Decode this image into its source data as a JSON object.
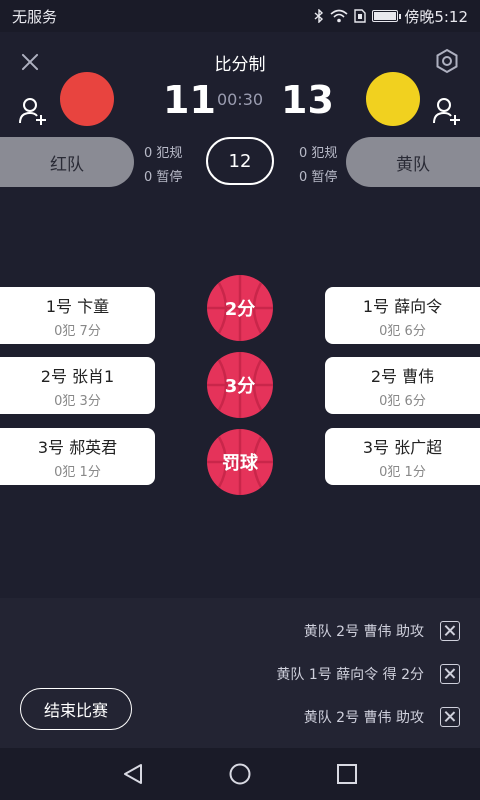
{
  "status_bar": {
    "carrier": "无服务",
    "time": "傍晚5:12",
    "icons": [
      "bluetooth-icon",
      "wifi-icon",
      "sim-icon",
      "battery-icon"
    ],
    "battery_level": 0.9
  },
  "header": {
    "title": "比分制",
    "clock": "00:30",
    "close_icon": "close-icon",
    "settings_icon": "settings-icon"
  },
  "teams": {
    "left": {
      "name": "红队",
      "color": "#e8443f",
      "score": "11",
      "fouls": "0 犯规",
      "timeouts": "0 暂停"
    },
    "right": {
      "name": "黄队",
      "color": "#f1d11f",
      "score": "13",
      "fouls": "0 犯规",
      "timeouts": "0 暂停"
    }
  },
  "period": "12",
  "players_left": [
    {
      "name": "1号 卞童",
      "stats": "0犯 7分"
    },
    {
      "name": "2号 张肖1",
      "stats": "0犯 3分"
    },
    {
      "name": "3号 郝英君",
      "stats": "0犯 1分"
    }
  ],
  "players_right": [
    {
      "name": "1号 薛向令",
      "stats": "0犯 6分"
    },
    {
      "name": "2号 曹伟",
      "stats": "0犯 6分"
    },
    {
      "name": "3号 张广超",
      "stats": "0犯 1分"
    }
  ],
  "score_buttons": [
    "2分",
    "3分",
    "罚球"
  ],
  "accent": "#e5335a",
  "log": [
    "黄队 2号 曹伟 助攻",
    "黄队 1号 薛向令 得 2分",
    "黄队 2号 曹伟 助攻"
  ],
  "end_button": "结束比赛",
  "nav": [
    "back-icon",
    "home-icon",
    "recent-apps-icon"
  ]
}
